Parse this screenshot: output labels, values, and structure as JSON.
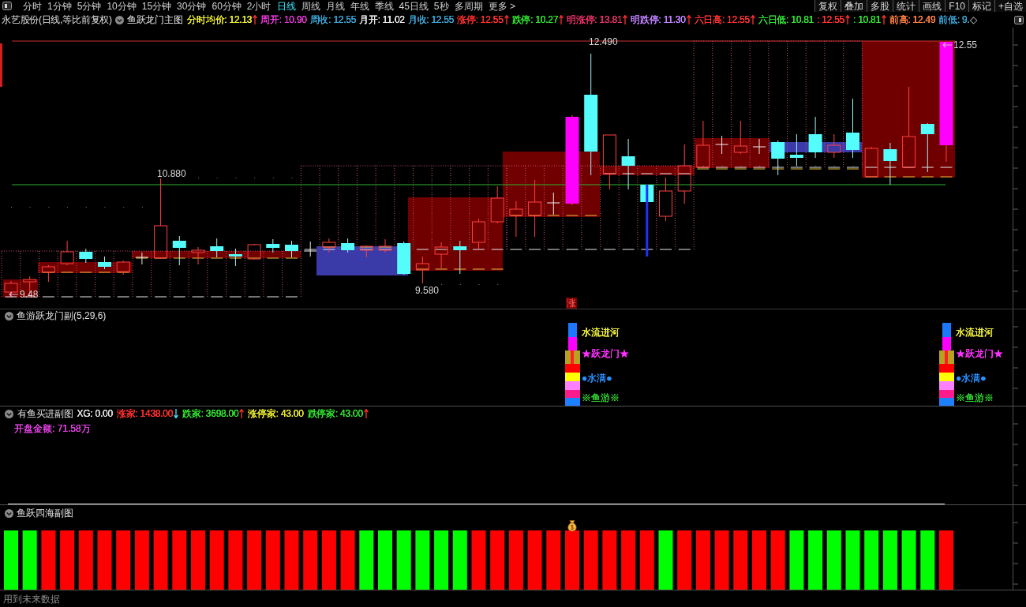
{
  "toolbar": {
    "period_tabs": [
      {
        "label": "分时",
        "selected": false
      },
      {
        "label": "1分钟",
        "selected": false
      },
      {
        "label": "5分钟",
        "selected": false
      },
      {
        "label": "10分钟",
        "selected": false
      },
      {
        "label": "15分钟",
        "selected": false
      },
      {
        "label": "30分钟",
        "selected": false
      },
      {
        "label": "60分钟",
        "selected": false
      },
      {
        "label": "2小时",
        "selected": false
      },
      {
        "label": "日线",
        "selected": true
      },
      {
        "label": "周线",
        "selected": false
      },
      {
        "label": "月线",
        "selected": false
      },
      {
        "label": "年线",
        "selected": false
      },
      {
        "label": "季线",
        "selected": false
      },
      {
        "label": "45日线",
        "selected": false
      },
      {
        "label": "5秒",
        "selected": false
      },
      {
        "label": "多周期",
        "selected": false
      },
      {
        "label": "更多 >",
        "selected": false
      }
    ],
    "tools": [
      "复权",
      "叠加",
      "多股",
      "统计",
      "画线",
      "F10",
      "标记",
      "+自选"
    ]
  },
  "info_bar": {
    "stock": "永艺股份(日线,等比前复权)",
    "indicator": "鱼跃龙门主图",
    "readings": [
      {
        "text": "分时均价: 12.13",
        "color": "#e8e830",
        "up": true,
        "down": false
      },
      {
        "text": "周开: 10.90",
        "color": "#e838d8",
        "up": false,
        "down": false
      },
      {
        "text": "周收: 12.55",
        "color": "#3aa0d0",
        "up": false,
        "down": false
      },
      {
        "text": "月开: 11.02",
        "color": "#e8e8e8",
        "up": false,
        "down": false
      },
      {
        "text": "月收: 12.55",
        "color": "#3ba1d1",
        "up": false,
        "down": false
      },
      {
        "text": "涨停: 12.55",
        "color": "#ff3030",
        "up": true,
        "down": false
      },
      {
        "text": "跌停: 10.27",
        "color": "#30e030",
        "up": true,
        "down": false
      },
      {
        "text": "明涨停: 13.81",
        "color": "#e83068",
        "up": true,
        "down": false
      },
      {
        "text": "明跌停: 11.30",
        "color": "#c080ff",
        "up": true,
        "down": false
      },
      {
        "text": "六日高: 12.55",
        "color": "#ff3131",
        "up": true,
        "down": false
      },
      {
        "text": "六日低: 10.81",
        "color": "#31e031",
        "up": false,
        "down": false
      },
      {
        "text": ": 12.55",
        "color": "#ff3232",
        "up": true,
        "down": false
      },
      {
        "text": ": 10.81",
        "color": "#32e032",
        "up": true,
        "down": false
      },
      {
        "text": "前高: 12.49",
        "color": "#ff8040",
        "up": false,
        "down": false
      },
      {
        "text": "前低: 9.",
        "color": "#3ca2d2",
        "up": false,
        "down": false
      }
    ],
    "tail": "◇"
  },
  "main_chart": {
    "price_labels": [
      {
        "text": "12.490",
        "kind": "peak"
      },
      {
        "text": "10.880",
        "kind": "peak"
      },
      {
        "text": "9.580",
        "kind": "trough"
      },
      {
        "text": "9.48",
        "kind": "pointer"
      },
      {
        "text": "12.55",
        "kind": "pointer"
      }
    ],
    "rise_marker": "涨"
  },
  "signal_panel": {
    "title": "鱼游跃龙门副(5,29,6)",
    "groups": [
      {
        "lines": [
          {
            "text": "水流进河",
            "color": "#f0f040"
          },
          {
            "text": "★跃龙门★",
            "color": "#ff30ff"
          },
          {
            "text": "●水满●",
            "color": "#2890ff"
          },
          {
            "text": "※鱼游※",
            "color": "#30d030"
          }
        ]
      },
      {
        "lines": [
          {
            "text": "水流进河",
            "color": "#f0f041"
          },
          {
            "text": "★跃龙门★",
            "color": "#ff31ff"
          },
          {
            "text": "●水满●",
            "color": "#2991ff"
          },
          {
            "text": "※鱼游※",
            "color": "#31d031"
          }
        ]
      }
    ]
  },
  "buy_panel": {
    "title": "有鱼买进副图",
    "readings": [
      {
        "text": "XG: 0.00",
        "color": "#e0e0e0",
        "up": false,
        "down": false
      },
      {
        "text": "涨家: 1438.00",
        "color": "#ff3030",
        "up": false,
        "down": true
      },
      {
        "text": "跌家: 3698.00",
        "color": "#30e030",
        "up": true,
        "down": false
      },
      {
        "text": "涨停家: 43.00",
        "color": "#e8e830",
        "up": false,
        "down": false
      },
      {
        "text": "跌停家: 43.00",
        "color": "#31e031",
        "up": true,
        "down": false
      }
    ],
    "open_amount": {
      "text": "开盘金额: 71.58万",
      "color": "#e040e0"
    }
  },
  "bar_panel": {
    "title": "鱼跃四海副图",
    "bars": [
      {
        "color": "#00ff00",
        "bag": false
      },
      {
        "color": "#00ff00",
        "bag": false
      },
      {
        "color": "#ff0000",
        "bag": false
      },
      {
        "color": "#ff0000",
        "bag": false
      },
      {
        "color": "#ff0000",
        "bag": false
      },
      {
        "color": "#ff0000",
        "bag": false
      },
      {
        "color": "#ff0000",
        "bag": false
      },
      {
        "color": "#ff0000",
        "bag": false
      },
      {
        "color": "#ff0000",
        "bag": false
      },
      {
        "color": "#ff0000",
        "bag": false
      },
      {
        "color": "#ff0000",
        "bag": false
      },
      {
        "color": "#ff0000",
        "bag": false
      },
      {
        "color": "#ff0000",
        "bag": false
      },
      {
        "color": "#ff0000",
        "bag": false
      },
      {
        "color": "#ff0000",
        "bag": false
      },
      {
        "color": "#ff0000",
        "bag": false
      },
      {
        "color": "#ff0000",
        "bag": false
      },
      {
        "color": "#ff0000",
        "bag": false
      },
      {
        "color": "#ff0000",
        "bag": false
      },
      {
        "color": "#00ff00",
        "bag": false
      },
      {
        "color": "#00ff00",
        "bag": false
      },
      {
        "color": "#00ff00",
        "bag": false
      },
      {
        "color": "#00ff00",
        "bag": false
      },
      {
        "color": "#00ff00",
        "bag": false
      },
      {
        "color": "#00ff00",
        "bag": false
      },
      {
        "color": "#ff0000",
        "bag": false
      },
      {
        "color": "#ff0000",
        "bag": false
      },
      {
        "color": "#ff0000",
        "bag": false
      },
      {
        "color": "#ff0000",
        "bag": false
      },
      {
        "color": "#ff0000",
        "bag": false
      },
      {
        "color": "#ff0000",
        "bag": true
      },
      {
        "color": "#ff0000",
        "bag": false
      },
      {
        "color": "#ff0000",
        "bag": false
      },
      {
        "color": "#ff0000",
        "bag": false
      },
      {
        "color": "#ff0000",
        "bag": false
      },
      {
        "color": "#00ff00",
        "bag": false
      },
      {
        "color": "#ff0000",
        "bag": false
      },
      {
        "color": "#ff0000",
        "bag": false
      },
      {
        "color": "#ff0000",
        "bag": false
      },
      {
        "color": "#ff0000",
        "bag": false
      },
      {
        "color": "#ff0000",
        "bag": false
      },
      {
        "color": "#ff0000",
        "bag": false
      },
      {
        "color": "#00ff00",
        "bag": false
      },
      {
        "color": "#00ff00",
        "bag": false
      },
      {
        "color": "#00ff00",
        "bag": false
      },
      {
        "color": "#00ff00",
        "bag": false
      },
      {
        "color": "#00ff00",
        "bag": false
      },
      {
        "color": "#00ff00",
        "bag": false
      },
      {
        "color": "#00ff00",
        "bag": false
      },
      {
        "color": "#00ff00",
        "bag": false
      },
      {
        "color": "#ff0000",
        "bag": false
      }
    ]
  },
  "status_bar": {
    "text": "用到未来数据"
  }
}
